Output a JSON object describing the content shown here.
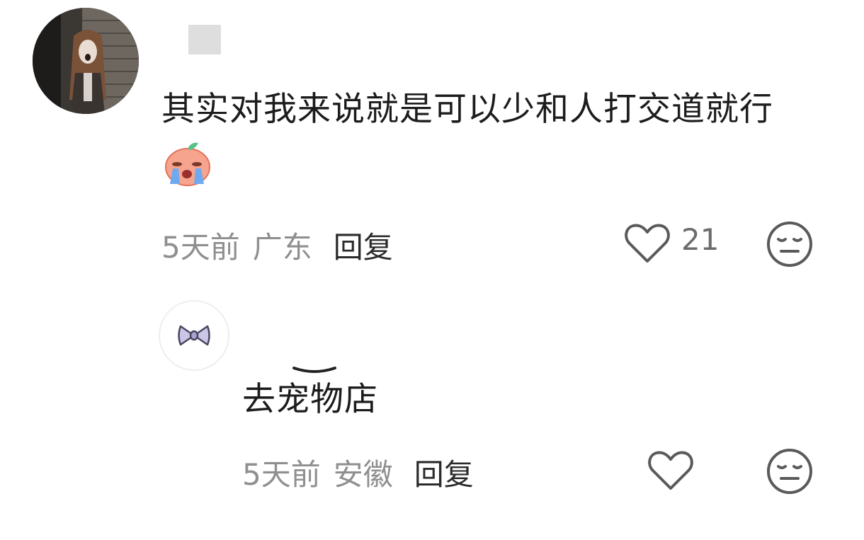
{
  "comments": [
    {
      "text": "其实对我来说就是可以少和人打交道就行",
      "emoji_icon": "crying-peach-emoji-icon",
      "time": "5天前",
      "region": "广东",
      "reply_label": "回复",
      "like_count": "21",
      "liked": false
    }
  ],
  "replies": [
    {
      "text": "去宠物店",
      "time": "5天前",
      "region": "安徽",
      "reply_label": "回复",
      "liked": false
    }
  ],
  "icons": {
    "like": "heart-outline-icon",
    "dislike": "meh-face-icon",
    "sub_avatar": "bow-icon"
  },
  "colors": {
    "meta_gray": "#8f8f8f",
    "text": "#1c1c1c",
    "icon_stroke": "#5a5a5a"
  }
}
